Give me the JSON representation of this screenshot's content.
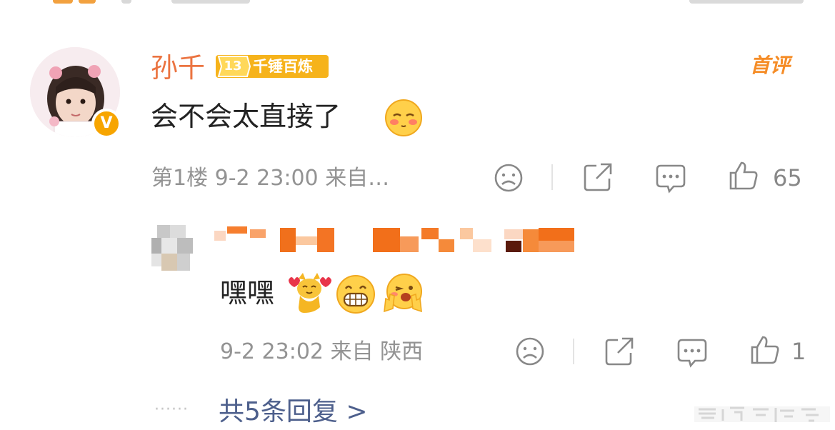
{
  "top_bar": {},
  "main_comment": {
    "username": "孙千",
    "level": "13",
    "level_title": "千锤百炼",
    "first_badge": "首评",
    "text": "会不会太直接了",
    "floor": "第1楼",
    "time": "9-2 23:00",
    "source": "来自…",
    "like_count": "65",
    "colors": {
      "username": "#eb7340",
      "badge": "#f6b31b",
      "text": "#222222",
      "meta": "#939393"
    }
  },
  "reply": {
    "text": "嘿嘿",
    "time": "9-2 23:02",
    "source": "来自 陕西",
    "like_count": "1"
  },
  "more_replies_label": "共5条回复 >",
  "icons": [
    "sad-face-icon",
    "share-icon",
    "comment-icon",
    "thumbs-up-icon",
    "blush-emoji-icon",
    "cat-hearts-sticker-icon",
    "grin-emoji-icon",
    "wink-peace-emoji-icon",
    "verified-v-icon"
  ]
}
